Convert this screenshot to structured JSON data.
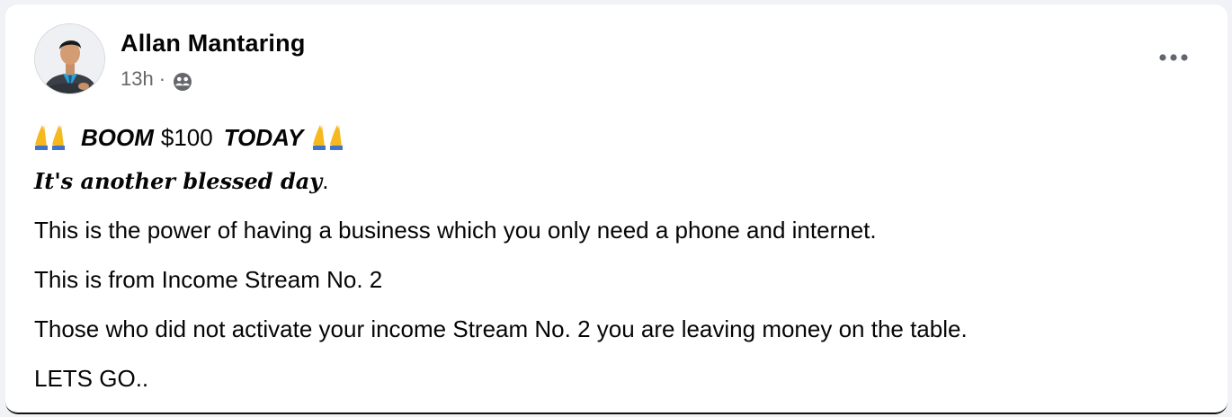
{
  "author": {
    "name": "Allan Mantaring",
    "time": "13h",
    "separator": "·",
    "audience_icon": "friends-icon"
  },
  "post": {
    "emoji": "🙏",
    "headline": {
      "part1": "BOOM",
      "part2": "$100",
      "part3": "TODAY"
    },
    "blessed_text": "It's another blessed day",
    "blessed_period": ".",
    "lines": [
      "This is the power of having a business which you only need a phone and internet.",
      "This is from Income Stream No. 2",
      "Those who did not activate your income Stream No. 2 you are leaving money on the table.",
      "LETS GO.."
    ]
  },
  "colors": {
    "name": "#050505",
    "meta": "#65676b",
    "emoji_gold": "#f5b81f",
    "emoji_blue": "#3f74c9"
  }
}
